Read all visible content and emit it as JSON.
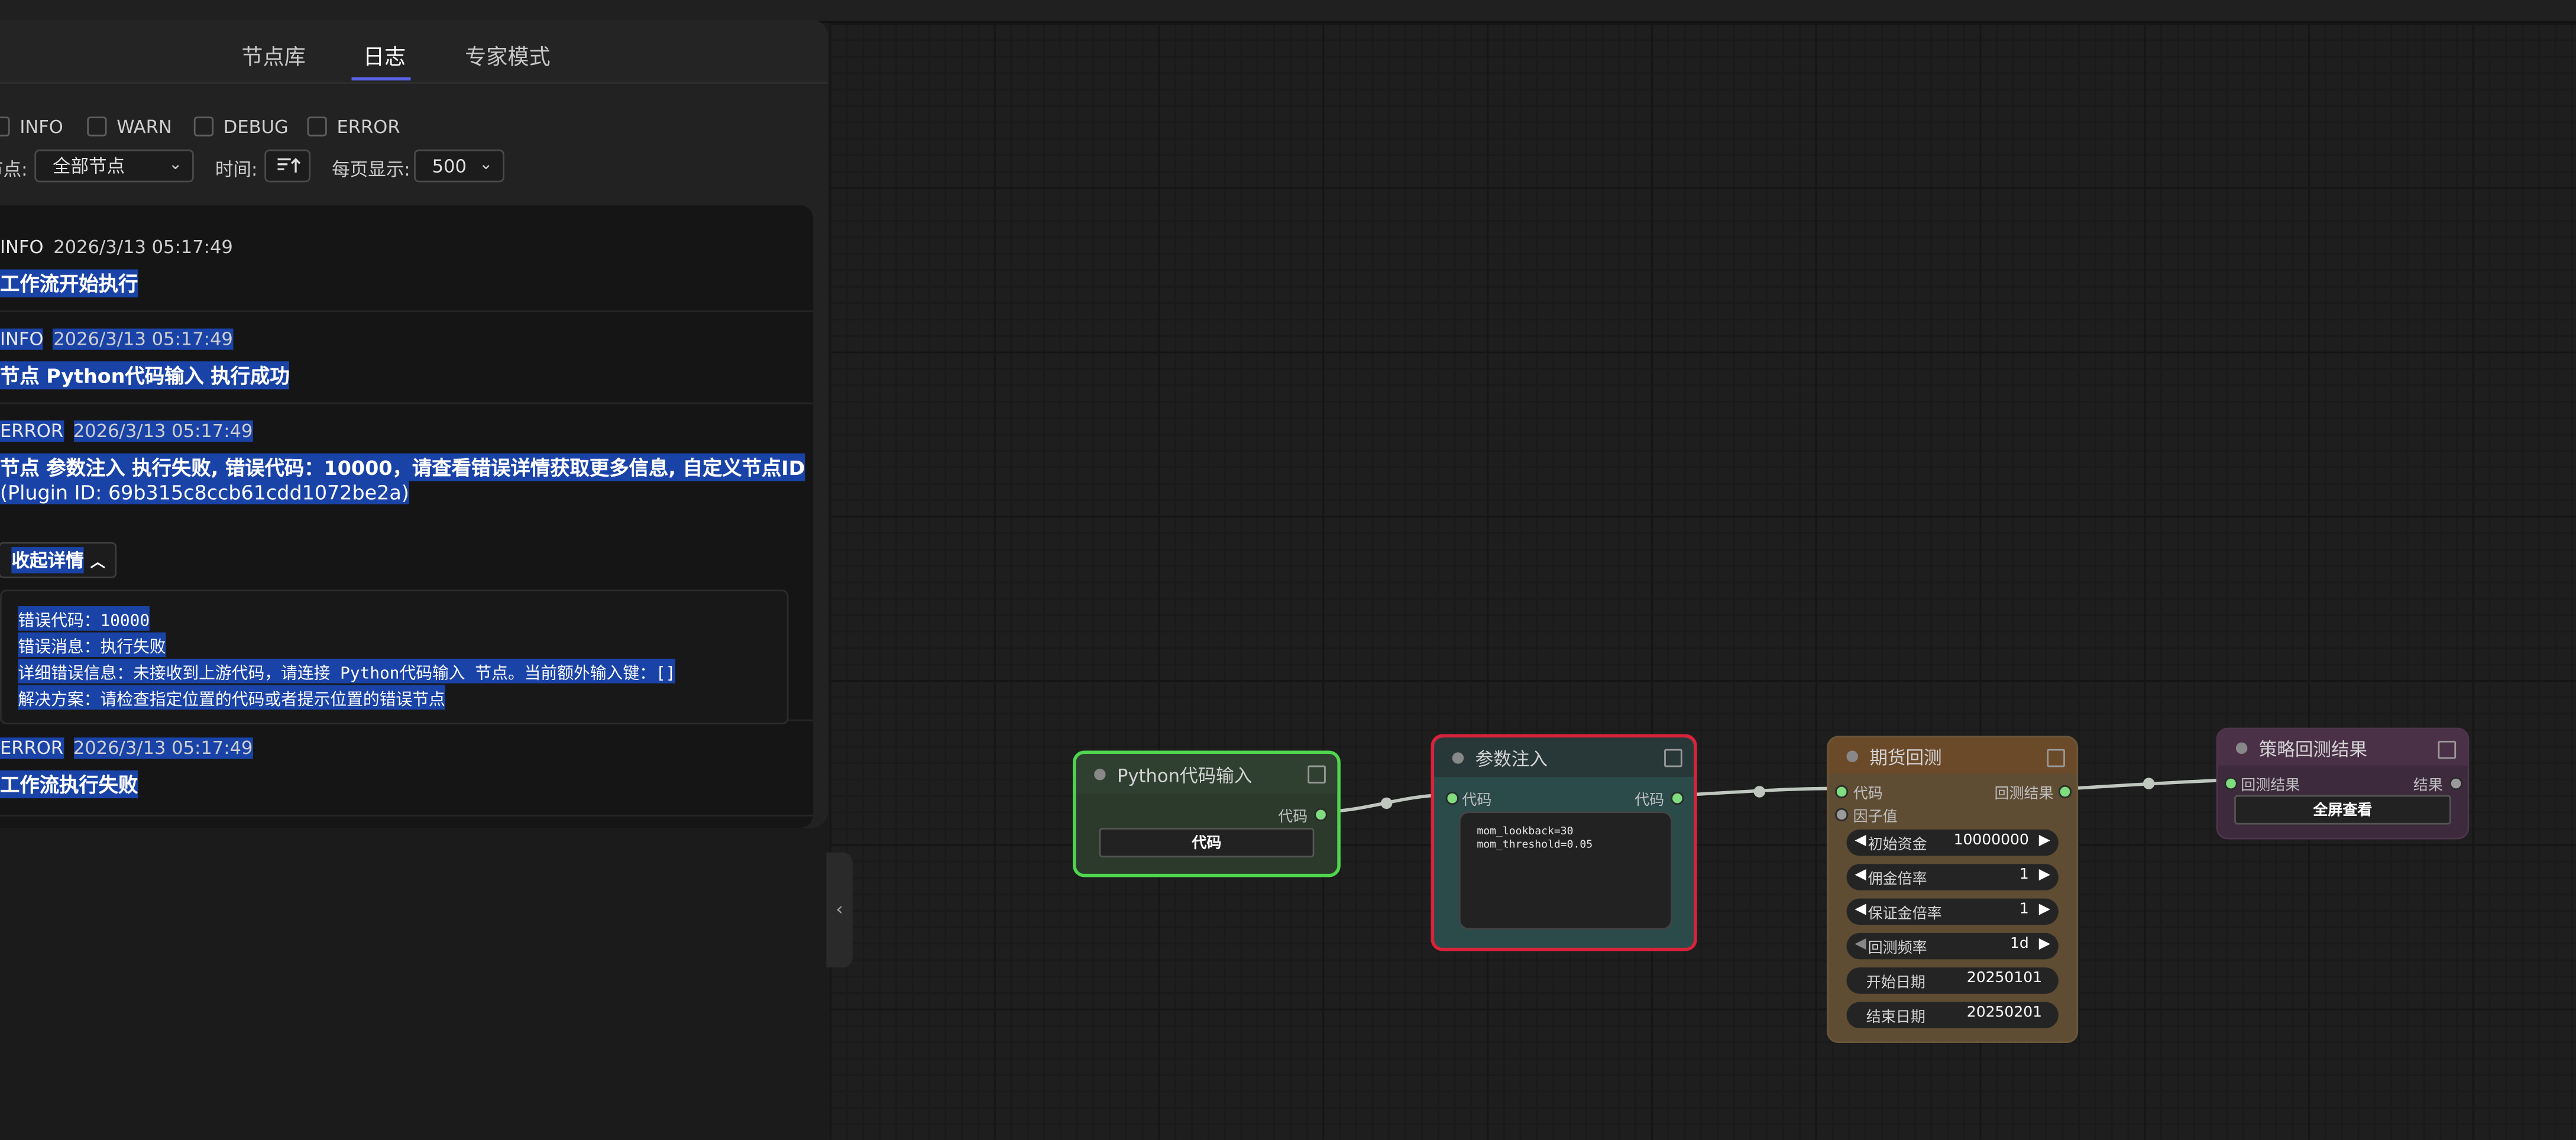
{
  "tabs": {
    "library": "节点库",
    "log": "日志",
    "expert": "专家模式"
  },
  "filters": {
    "info": "INFO",
    "warn": "WARN",
    "debug": "DEBUG",
    "error": "ERROR"
  },
  "controls": {
    "node_label": "节点:",
    "node_select": "全部节点",
    "time_label": "时间:",
    "page_label": "每页显示:",
    "page_select": "500"
  },
  "logs": [
    {
      "level": "INFO",
      "time": "2026/3/13 05:17:49",
      "message": "工作流开始执行"
    },
    {
      "level": "INFO",
      "time": "2026/3/13 05:17:49",
      "message": "节点 Python代码输入 执行成功"
    },
    {
      "level": "ERROR",
      "time": "2026/3/13 05:17:49",
      "message": "节点 参数注入 执行失败, 错误代码：10000，请查看错误详情获取更多信息, 自定义节点ID",
      "message2": "(Plugin ID: 69b315c8ccb61cdd1072be2a)",
      "collapse_label": "收起详情",
      "details": [
        "错误代码：10000",
        "错误消息：执行失败",
        "详细错误信息：未接收到上游代码，请连接 Python代码输入 节点。当前额外输入键：[]",
        "解决方案：请检查指定位置的代码或者提示位置的错误节点"
      ]
    },
    {
      "level": "ERROR",
      "time": "2026/3/13 05:17:49",
      "message": "工作流执行失败"
    }
  ],
  "nodes": {
    "python": {
      "title": "Python代码输入",
      "out_port": "代码",
      "button": "代码"
    },
    "param": {
      "title": "参数注入",
      "in_port": "代码",
      "out_port": "代码",
      "code_lines": [
        "mom_lookback=30",
        "mom_threshold=0.05"
      ]
    },
    "futures": {
      "title": "期货回测",
      "in_code": "代码",
      "in_factor": "因子值",
      "out_result": "回测结果",
      "widgets": [
        {
          "label": "初始资金",
          "value": "10000000"
        },
        {
          "label": "佣金倍率",
          "value": "1"
        },
        {
          "label": "保证金倍率",
          "value": "1"
        },
        {
          "label": "回测频率",
          "value": "1d"
        },
        {
          "label": "开始日期",
          "value": "20250101"
        },
        {
          "label": "结束日期",
          "value": "20250201"
        }
      ]
    },
    "result": {
      "title": "策略回测结果",
      "in_port": "回测结果",
      "out_port": "结果",
      "button": "全屏查看"
    }
  },
  "colors": {
    "accent": "#5a63e6",
    "selection": "#1a43a8",
    "python_border": "#4fd64f",
    "param_border": "#d9233b",
    "futures_head": "#6b4a2a",
    "result_head": "#4a3148"
  }
}
